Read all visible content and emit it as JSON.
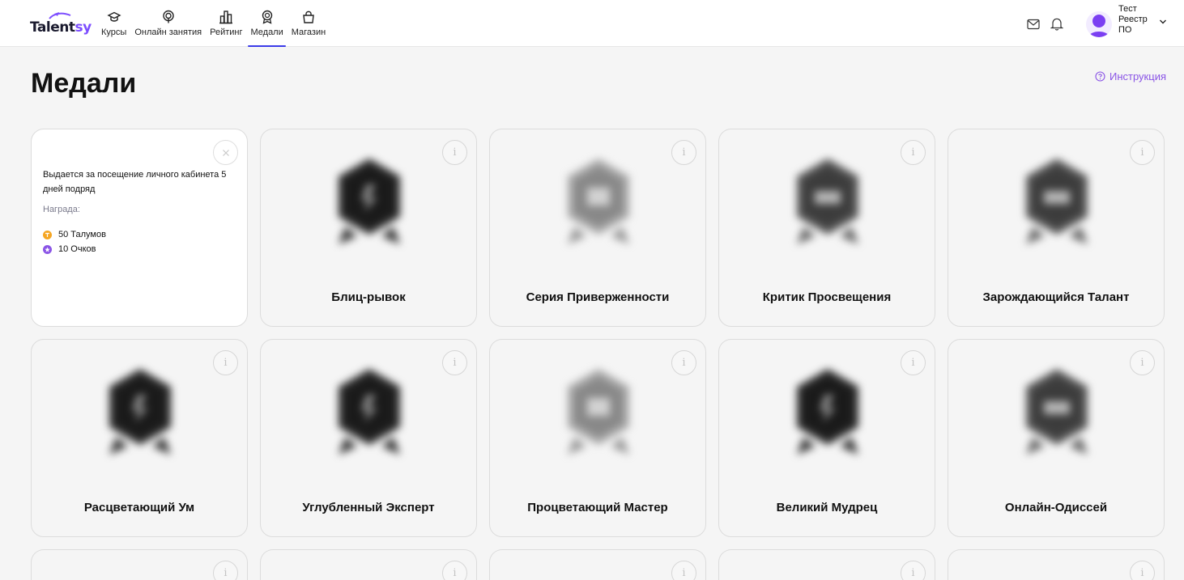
{
  "header": {
    "logo_prefix": "Talent",
    "logo_suffix": "sy",
    "nav": [
      {
        "label": "Курсы",
        "icon": "graduation-cap-icon"
      },
      {
        "label": "Онлайн занятия",
        "icon": "podcast-icon"
      },
      {
        "label": "Рейтинг",
        "icon": "rating-bars-icon"
      },
      {
        "label": "Медали",
        "icon": "medal-icon",
        "active": true
      },
      {
        "label": "Магазин",
        "icon": "shopping-bag-icon"
      }
    ],
    "user": {
      "line1": "Тест",
      "line2": "Реестр",
      "line3": "ПО"
    }
  },
  "page": {
    "title": "Медали",
    "instruction": "Инструкция"
  },
  "open_card": {
    "description": "Выдается за посещение личного кабинета 5 дней подряд",
    "reward_label": "Награда:",
    "rewards": [
      {
        "text": "50 Талумов",
        "color": "#f5a623"
      },
      {
        "text": "10 Очков",
        "color": "#8a54e6"
      }
    ]
  },
  "medals": [
    {
      "name": "Блиц-рывок",
      "tone": "dark"
    },
    {
      "name": "Серия Приверженности",
      "tone": "light"
    },
    {
      "name": "Критик Просвещения",
      "tone": "mid"
    },
    {
      "name": "Зарождающийся Талант",
      "tone": "mid"
    },
    {
      "name": "Расцветающий Ум",
      "tone": "dark"
    },
    {
      "name": "Углубленный Эксперт",
      "tone": "dark"
    },
    {
      "name": "Процветающий Мастер",
      "tone": "light"
    },
    {
      "name": "Великий Мудрец",
      "tone": "dark"
    },
    {
      "name": "Онлайн-Одиссей",
      "tone": "mid"
    }
  ],
  "colors": {
    "accent": "#3b3be8",
    "link": "#8a54e6",
    "avatar": "#7b3ff2"
  }
}
